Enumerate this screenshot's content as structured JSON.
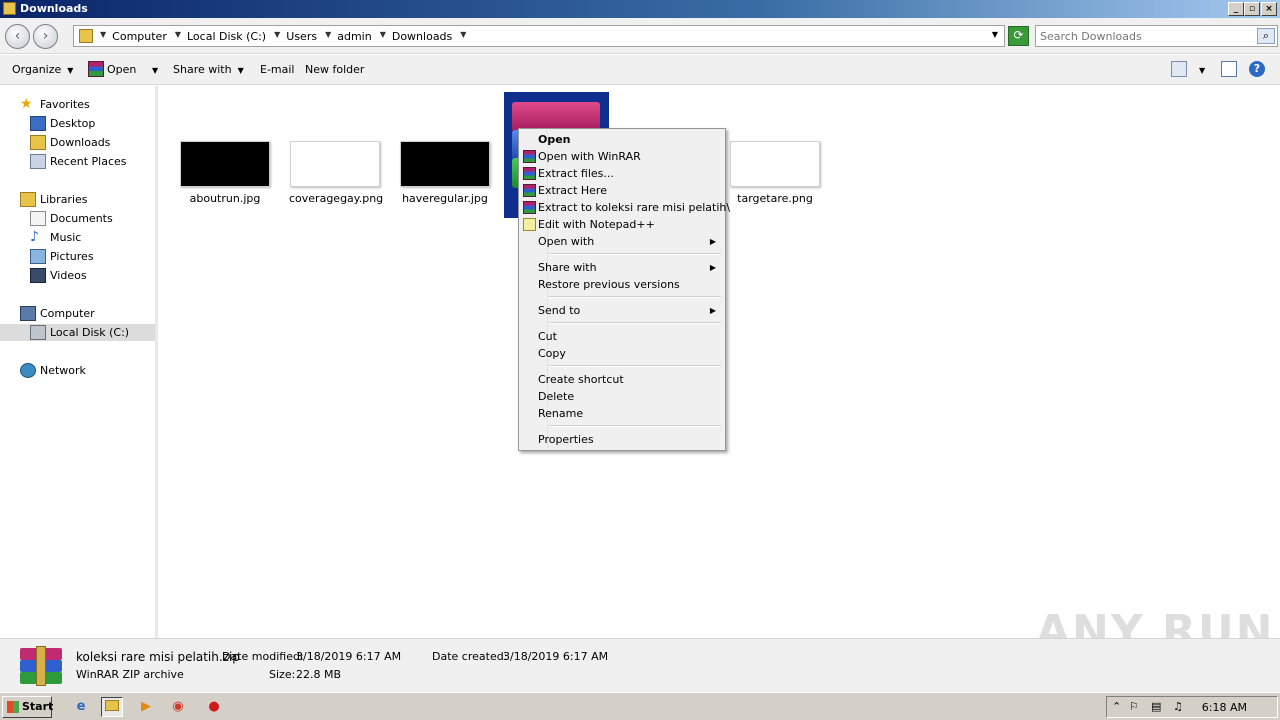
{
  "window": {
    "title": "Downloads"
  },
  "address": {
    "crumbs": [
      "Computer",
      "Local Disk (C:)",
      "Users",
      "admin",
      "Downloads"
    ]
  },
  "search": {
    "placeholder": "Search Downloads"
  },
  "commands": {
    "organize": "Organize",
    "open": "Open",
    "share_with": "Share with",
    "email": "E-mail",
    "new_folder": "New folder"
  },
  "nav": {
    "favorites": "Favorites",
    "desktop": "Desktop",
    "downloads": "Downloads",
    "recent_places": "Recent Places",
    "libraries": "Libraries",
    "documents": "Documents",
    "music": "Music",
    "pictures": "Pictures",
    "videos": "Videos",
    "computer": "Computer",
    "local_disk": "Local Disk (C:)",
    "network": "Network"
  },
  "files": [
    {
      "name": "aboutrun.jpg"
    },
    {
      "name": "coveragegay.png"
    },
    {
      "name": "haveregular.jpg"
    },
    {
      "name": "targetare.png"
    }
  ],
  "context_menu": {
    "open": "Open",
    "open_with_winrar": "Open with WinRAR",
    "extract_files": "Extract files...",
    "extract_here": "Extract Here",
    "extract_to": "Extract to koleksi rare misi pelatih\\",
    "edit_notepad": "Edit with Notepad++",
    "open_with": "Open with",
    "share_with": "Share with",
    "restore": "Restore previous versions",
    "send_to": "Send to",
    "cut": "Cut",
    "copy": "Copy",
    "create_shortcut": "Create shortcut",
    "delete": "Delete",
    "rename": "Rename",
    "properties": "Properties"
  },
  "details": {
    "filename": "koleksi rare misi pelatih.zip",
    "filetype": "WinRAR ZIP archive",
    "modified_label": "Date modified:",
    "modified_value": "3/18/2019 6:17 AM",
    "created_label": "Date created:",
    "created_value": "3/18/2019 6:17 AM",
    "size_label": "Size:",
    "size_value": "22.8 MB"
  },
  "watermark": "ANY RUN",
  "taskbar": {
    "start": "Start",
    "clock": "6:18 AM"
  },
  "colors": {
    "selection": "#0f2f8f",
    "titlebar": "#0a246a"
  }
}
